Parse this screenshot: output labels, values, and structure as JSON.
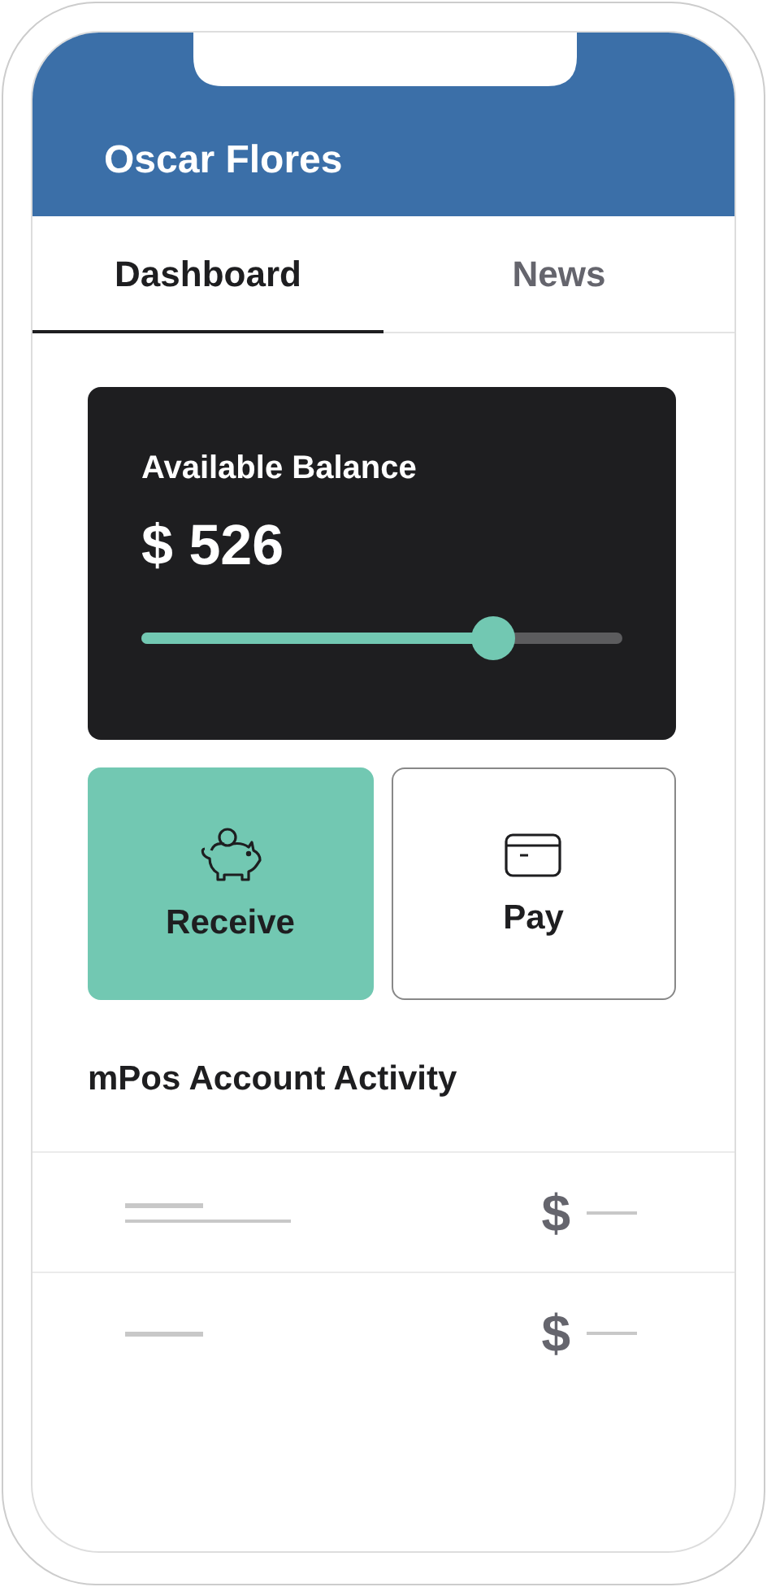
{
  "header": {
    "title": "Oscar Flores"
  },
  "tabs": [
    {
      "label": "Dashboard",
      "selected": true
    },
    {
      "label": "News",
      "selected": false
    }
  ],
  "balance": {
    "label": "Available Balance",
    "amount": "$ 526",
    "level": 0.73
  },
  "actions": [
    {
      "label": "Receive",
      "kind": "piggy",
      "selected": true
    },
    {
      "label": "Pay",
      "kind": "card",
      "selected": false
    }
  ],
  "activity": {
    "title": "mPos Account Activity",
    "rows": [
      {
        "kind": "two-line",
        "currency": "$"
      },
      {
        "kind": "one-line",
        "currency": "$"
      }
    ]
  }
}
